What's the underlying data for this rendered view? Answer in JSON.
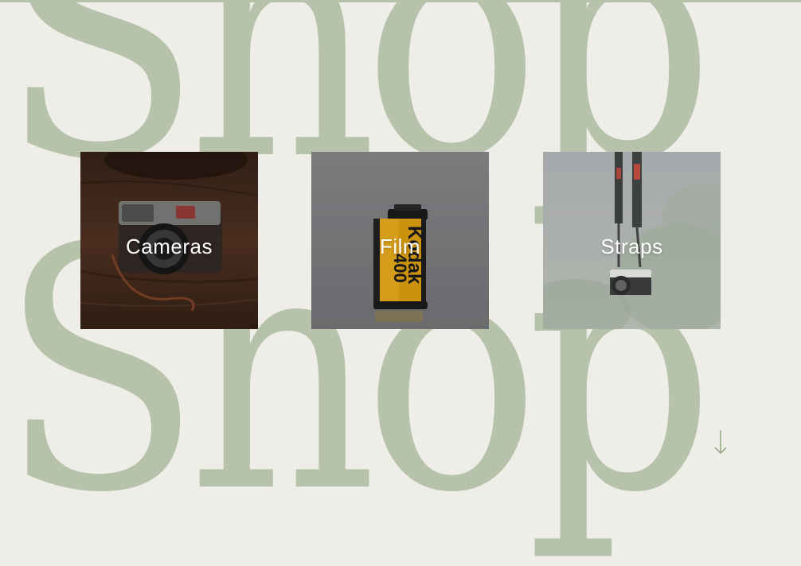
{
  "background": {
    "word": "Shop",
    "color": "#b6c2aa",
    "page_color": "#eeede8"
  },
  "categories": [
    {
      "label": "Cameras",
      "image": "vintage-camera-photo"
    },
    {
      "label": "Film",
      "image": "film-canister-photo"
    },
    {
      "label": "Straps",
      "image": "camera-strap-photo"
    }
  ],
  "scroll_indicator": {
    "icon": "arrow-down-icon",
    "color": "#9aab8c"
  }
}
